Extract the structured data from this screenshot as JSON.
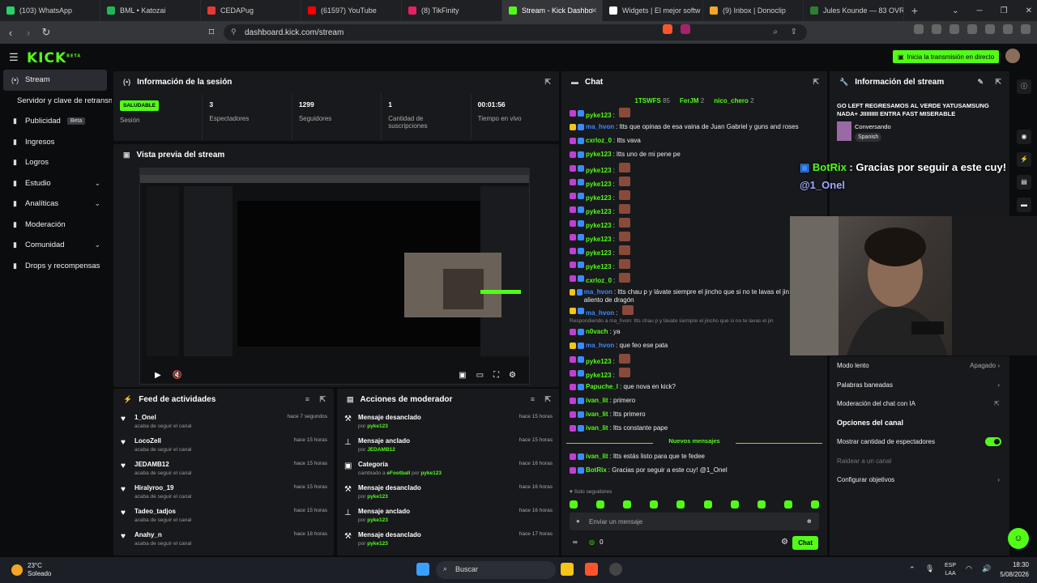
{
  "browser": {
    "tabs": [
      {
        "label": "(103) WhatsApp",
        "color": "#25d366"
      },
      {
        "label": "BML • Katozai",
        "color": "#1db954"
      },
      {
        "label": "CEDAPug",
        "color": "#e53935"
      },
      {
        "label": "(61597) YouTube",
        "color": "#ff0000"
      },
      {
        "label": "(8) TikFinity",
        "color": "#e91e63"
      },
      {
        "label": "Stream - Kick Dashbo",
        "color": "#53fc18",
        "active": true
      },
      {
        "label": "Widgets | El mejor softw",
        "color": "#ffffff"
      },
      {
        "label": "(9) Inbox | Donoclip",
        "color": "#f5a623"
      },
      {
        "label": "Jules Kounde — 83 OVR |",
        "color": "#2e7d32"
      }
    ],
    "url": "dashboard.kick.com/stream"
  },
  "header": {
    "logo": "KICK",
    "logo_sup": "BETA",
    "go_live": "Inicia la transmisión en directo"
  },
  "sidebar": {
    "items": [
      {
        "label": "Stream",
        "icon": "stream-icon",
        "active": true
      },
      {
        "label": "Servidor y clave de retransmisión",
        "icon": ""
      },
      {
        "label": "Publicidad",
        "icon": "ads-icon",
        "badge": "Beta"
      },
      {
        "label": "Ingresos",
        "icon": "income-icon"
      },
      {
        "label": "Logros",
        "icon": "achievements-icon"
      },
      {
        "label": "Estudio",
        "icon": "studio-icon",
        "chevron": true
      },
      {
        "label": "Analíticas",
        "icon": "analytics-icon",
        "chevron": true
      },
      {
        "label": "Moderación",
        "icon": "moderation-icon"
      },
      {
        "label": "Comunidad",
        "icon": "community-icon",
        "chevron": true
      },
      {
        "label": "Drops y recompensas",
        "icon": "drops-icon"
      }
    ]
  },
  "session": {
    "title": "Información de la sesión",
    "health_badge": "SALUDABLE",
    "health_label": "Sesión",
    "stats": [
      {
        "value": "3",
        "label": "Espectadores"
      },
      {
        "value": "1299",
        "label": "Seguidores"
      },
      {
        "value": "1",
        "label": "Cantidad de suscripciones"
      },
      {
        "value": "00:01:56",
        "label": "Tiempo en vivo"
      }
    ]
  },
  "preview": {
    "title": "Vista previa del stream"
  },
  "feed": {
    "title": "Feed de actividades",
    "rows": [
      {
        "name": "1_Onel",
        "sub": "acaba de seguir el canal",
        "time": "hace 7 segundos"
      },
      {
        "name": "LocoZell",
        "sub": "acaba de seguir el canal",
        "time": "hace 15 horas"
      },
      {
        "name": "JEDAMB12",
        "sub": "acaba de seguir el canal",
        "time": "hace 15 horas"
      },
      {
        "name": "Hiralyroo_19",
        "sub": "acaba de seguir el canal",
        "time": "hace 15 horas"
      },
      {
        "name": "Tadeo_tadjos",
        "sub": "acaba de seguir el canal",
        "time": "hace 15 horas"
      },
      {
        "name": "Anahy_n",
        "sub": "acaba de seguir el canal",
        "time": "hace 18 horas"
      }
    ]
  },
  "modactions": {
    "title": "Acciones de moderador",
    "rows": [
      {
        "name": "Mensaje desanclado",
        "pre": "por ",
        "by": "pyke123",
        "time": "hace 15 horas"
      },
      {
        "name": "Mensaje anclado",
        "pre": "por ",
        "by": "JEDAMB12",
        "time": "hace 15 horas"
      },
      {
        "name": "Categoría",
        "pre": "cambiado a ",
        "by": "eFootball",
        "post": " por ",
        "by2": "pyke123",
        "time": "hace 16 horas"
      },
      {
        "name": "Mensaje desanclado",
        "pre": "por ",
        "by": "pyke123",
        "time": "hace 16 horas"
      },
      {
        "name": "Mensaje anclado",
        "pre": "por ",
        "by": "pyke123",
        "time": "hace 16 horas"
      },
      {
        "name": "Mensaje desanclado",
        "pre": "por ",
        "by": "pyke123",
        "time": "hace 17 horas"
      }
    ]
  },
  "chat": {
    "title": "Chat",
    "pinned": [
      {
        "name": "1TSWFS",
        "count": "85"
      },
      {
        "name": "FerJM",
        "count": "2"
      },
      {
        "name": "nico_chero",
        "count": "2"
      }
    ],
    "messages": [
      {
        "user": "pyke123",
        "color": "#53fc18",
        "text": "",
        "emote": true
      },
      {
        "user": "ma_hvon",
        "color": "#3b8bff",
        "text": "ltts que opinas de esa vaina de Juan Gabriel y guns and roses"
      },
      {
        "user": "cxrloz_0",
        "color": "#53fc18",
        "text": "ltts vava"
      },
      {
        "user": "pyke123",
        "color": "#53fc18",
        "text": "ltts uno de mi pene pe"
      },
      {
        "user": "pyke123",
        "color": "#53fc18",
        "text": "",
        "emote": true
      },
      {
        "user": "pyke123",
        "color": "#53fc18",
        "text": "",
        "emote": true
      },
      {
        "user": "pyke123",
        "color": "#53fc18",
        "text": "",
        "emote": true
      },
      {
        "user": "pyke123",
        "color": "#53fc18",
        "text": "",
        "emote": true
      },
      {
        "user": "pyke123",
        "color": "#53fc18",
        "text": "",
        "emote": true
      },
      {
        "user": "pyke123",
        "color": "#53fc18",
        "text": "",
        "emote": true
      },
      {
        "user": "pyke123",
        "color": "#53fc18",
        "text": "",
        "emote": true
      },
      {
        "user": "pyke123",
        "color": "#53fc18",
        "text": "",
        "emote": true
      },
      {
        "user": "cxrloz_0",
        "color": "#53fc18",
        "text": "",
        "emote": true
      },
      {
        "user": "ma_hvon",
        "color": "#3b8bff",
        "text": "ltts chau p y lávate siempre el jincho que si no te lavas el jin pone aliento de dragón"
      },
      {
        "user": "ma_hvon",
        "color": "#3b8bff",
        "text": "",
        "emote": true
      },
      {
        "user": "n0vach",
        "color": "#53fc18",
        "text": "ya"
      },
      {
        "user": "ma_hvon",
        "color": "#3b8bff",
        "text": "que feo ese pata"
      },
      {
        "user": "pyke123",
        "color": "#53fc18",
        "text": "",
        "emote": true
      },
      {
        "user": "pyke123",
        "color": "#53fc18",
        "text": "",
        "emote": true
      },
      {
        "user": "Papuche_l",
        "color": "#53fc18",
        "text": "que nova en kick?"
      },
      {
        "user": "ivan_lit",
        "color": "#53fc18",
        "text": "primero"
      },
      {
        "user": "ivan_lit",
        "color": "#53fc18",
        "text": "ltts primero"
      },
      {
        "user": "ivan_lit",
        "color": "#53fc18",
        "text": "ltts constante pape"
      }
    ],
    "reply_hint": "Respondiendo a ma_hvon: ltts chau p y lávate siempre el jincho que si no te lavas el jin",
    "new_messages": "Nuevos mensajes",
    "after": [
      {
        "user": "ivan_lit",
        "color": "#53fc18",
        "text": "ltts estás listo para que te fedee"
      },
      {
        "user": "BotRix",
        "color": "#53fc18",
        "text": "Gracias por seguir a este cuy! @1_Onel"
      }
    ],
    "followers_only": "Solo seguidores",
    "input_placeholder": "Enviar un mensaje",
    "points": "0",
    "send": "Chat"
  },
  "info": {
    "title": "Información del stream",
    "stream_title": "GO LEFT REGRESAMOS AL VERDE YATUSAMSUNG NADA+ JIIIIIIIII ENTRA FAST MISERABLE",
    "category": "Conversando",
    "language": "Spanish"
  },
  "overlay": {
    "user": "BotRix",
    "text": " : Gracias por seguir a este cuy! ",
    "mention": "@1_Onel"
  },
  "settings": {
    "rows": [
      {
        "label": "Modo lento",
        "value": "Apagado"
      },
      {
        "label": "Palabras baneadas",
        "value": ""
      },
      {
        "label": "Moderación del chat con IA",
        "value": ""
      }
    ],
    "channel_title": "Opciones del canal",
    "show_viewers": "Mostrar cantidad de espectadores",
    "raid": "Raidear a un canal",
    "goals": "Configurar objetivos"
  },
  "taskbar": {
    "temp": "23°C",
    "weather": "Soleado",
    "search": "Buscar",
    "lang": "ESP",
    "lang2": "LAA",
    "time": "18:30",
    "date": "5/08/2026"
  }
}
